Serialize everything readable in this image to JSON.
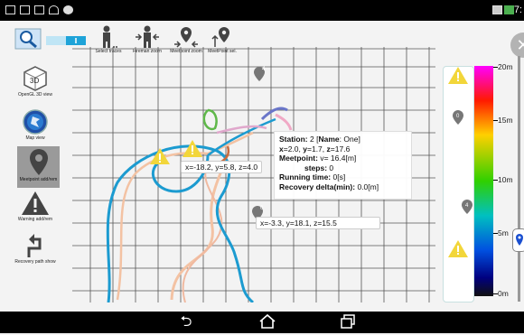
{
  "status_bar": {
    "time": "7:"
  },
  "toolbar": {
    "select_traces": "Select traces",
    "fireman_zoom": "Fireman zoom",
    "meetpoint_zoom": "Meetpoint zoom",
    "meetpoint_sel": "MeetPoint sel."
  },
  "sidebar": {
    "opengl": "OpenGL 3D view",
    "map_view": "Map view",
    "meetpoint_add": "Meetpoint add/rem",
    "warning_add": "Warning add/rem",
    "recovery_path": "Recovery path show",
    "icon_3d_text": "3D"
  },
  "map": {
    "coord1": "x=-18.2, y=5.8, z=4.0",
    "coord2": "x=-3.3, y=18.1, z=15.5",
    "marker_labels": {
      "m1": "4",
      "m2": "0",
      "m3": "0",
      "m4": "4"
    }
  },
  "info": {
    "station_label": "Station:",
    "station_value": "2",
    "name_label": "Name",
    "name_value": "One",
    "x_label": "x",
    "x_value": "2.0",
    "y_label": "y",
    "y_value": "1.7",
    "z_label": "z",
    "z_value": "17.6",
    "meetpoint_label": "Meetpoint:",
    "meetpoint_value": "v= 16.4[m]",
    "steps_label": "steps:",
    "steps_value": "0",
    "running_label": "Running time:",
    "running_value": "0[s]",
    "recovery_label": "Recovery delta(min):",
    "recovery_value": "0.0[m]"
  },
  "colorbar": {
    "labels": [
      "20m",
      "15m",
      "10m",
      "5m",
      "0m"
    ],
    "colors": [
      "#ff00ff",
      "#ff1a00",
      "#ffd000",
      "#30d000",
      "#00c0c0",
      "#0050e0",
      "#000080"
    ]
  },
  "scale_markers": {
    "m1": "0",
    "m2": "4"
  }
}
